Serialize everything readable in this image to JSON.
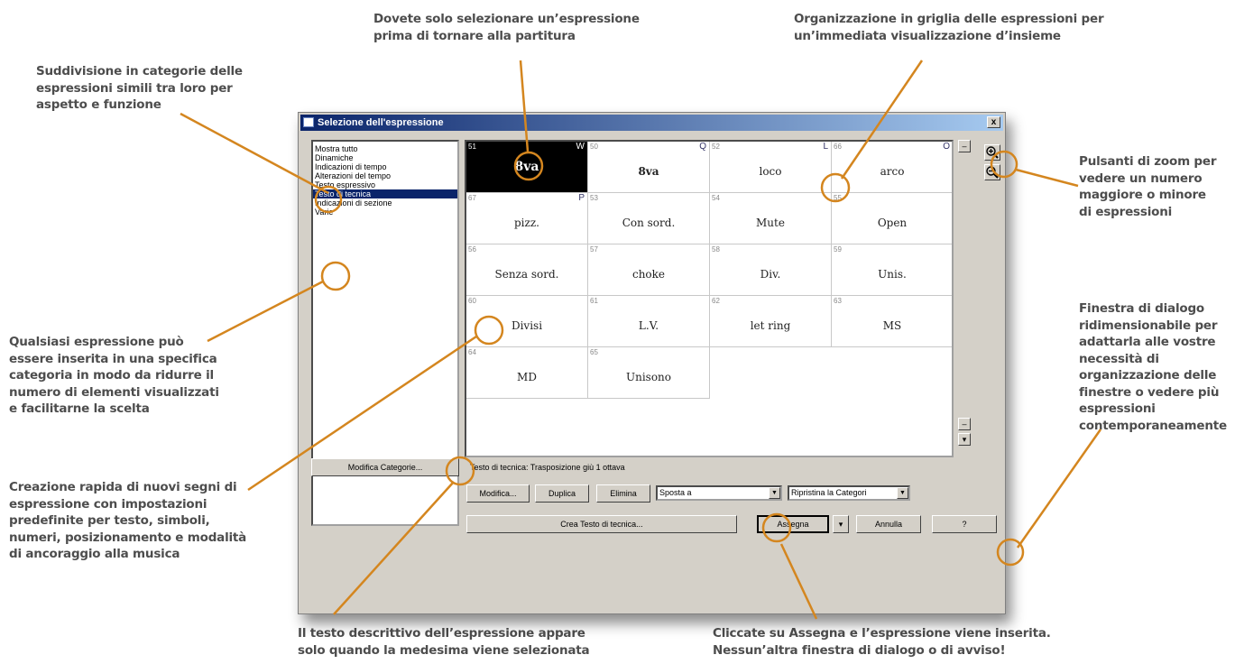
{
  "annotations": {
    "categories": "Suddivisione in categorie delle\nespressioni simili tra loro per\naspetto e funzione",
    "select": "Dovete solo selezionare un’espressione\nprima di tornare alla partitura",
    "grid": "Organizzazione in griglia delle espressioni per\nun’immediata visualizzazione d’insieme",
    "zoom": "Pulsanti di zoom per\nvedere un numero\nmaggiore o minore\ndi espressioni",
    "resize": "Finestra di dialogo\nridimensionabile per\nadattarla alle vostre\nnecessità di\norganizzazione delle\nfinestre o vedere più\nespressioni\ncontemporaneamente",
    "anycat": "Qualsiasi espressione può\nessere inserita in una specifica\ncategoria in modo da ridurre il\nnumero di elementi visualizzati\ne facilitarne la scelta",
    "create": "Creazione rapida di nuovi segni di\nespressione con impostazioni\npredefinite per testo, simboli,\nnumeri, posizionamento e modalità\ndi ancoraggio alla musica",
    "desc": "Il testo descrittivo dell’espressione appare\nsolo quando la medesima viene selezionata",
    "assign": "Cliccate su Assegna e l’espressione viene inserita.\nNessun’altra finestra di dialogo o di avviso!"
  },
  "dialog": {
    "title": "Selezione dell'espressione",
    "close_label": "x",
    "categories": [
      {
        "label": "Mostra tutto"
      },
      {
        "label": "Dinamiche"
      },
      {
        "label": "Indicazioni di tempo"
      },
      {
        "label": "Alterazioni del tempo"
      },
      {
        "label": "Testo espressivo"
      },
      {
        "label": "Testo di tecnica"
      },
      {
        "label": "Indicazioni di sezione"
      },
      {
        "label": "Varie"
      }
    ],
    "selected_category": "Testo di tecnica",
    "cells": [
      {
        "num": "51",
        "shortcut": "W",
        "text": "8va"
      },
      {
        "num": "50",
        "shortcut": "Q",
        "text": "8va"
      },
      {
        "num": "52",
        "shortcut": "L",
        "text": "loco"
      },
      {
        "num": "66",
        "shortcut": "O",
        "text": "arco"
      },
      {
        "num": "67",
        "shortcut": "P",
        "text": "pizz."
      },
      {
        "num": "53",
        "shortcut": "",
        "text": "Con sord."
      },
      {
        "num": "54",
        "shortcut": "",
        "text": "Mute"
      },
      {
        "num": "55",
        "shortcut": "",
        "text": "Open"
      },
      {
        "num": "56",
        "shortcut": "",
        "text": "Senza sord."
      },
      {
        "num": "57",
        "shortcut": "",
        "text": "choke"
      },
      {
        "num": "58",
        "shortcut": "",
        "text": "Div."
      },
      {
        "num": "59",
        "shortcut": "",
        "text": "Unis."
      },
      {
        "num": "60",
        "shortcut": "",
        "text": "Divisi"
      },
      {
        "num": "61",
        "shortcut": "",
        "text": "L.V."
      },
      {
        "num": "62",
        "shortcut": "",
        "text": "let ring"
      },
      {
        "num": "63",
        "shortcut": "",
        "text": "MS"
      },
      {
        "num": "64",
        "shortcut": "",
        "text": "MD"
      },
      {
        "num": "65",
        "shortcut": "",
        "text": "Unisono"
      }
    ],
    "status_text": "Testo di tecnica: Trasposizione giù 1 ottava",
    "buttons": {
      "edit_categories": "Modifica Categorie...",
      "edit": "Modifica...",
      "duplicate": "Duplica",
      "delete": "Elimina",
      "move_to": "Sposta a",
      "restore": "Ripristina la Categori",
      "create": "Crea Testo di tecnica...",
      "assign": "Assegna",
      "cancel": "Annulla",
      "help": "?"
    },
    "colors": {
      "accent": "#d4861f",
      "titlebar": "#0a246a",
      "selection": "#0a246a"
    }
  }
}
